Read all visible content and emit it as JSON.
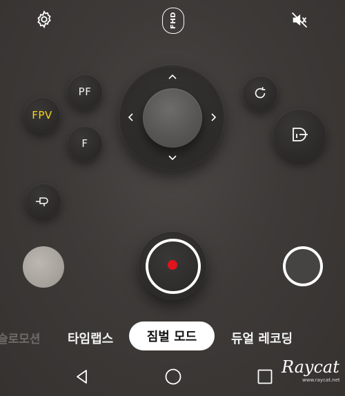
{
  "top_bar": {
    "settings_icon": "gear-icon",
    "resolution_label": "FHD",
    "audio_icon": "mute-icon"
  },
  "left_controls": {
    "pf_label": "PF",
    "fpv_label": "FPV",
    "f_label": "F",
    "recenter_icon": "gimbal-recenter-icon"
  },
  "joystick": {
    "arrows": [
      "up",
      "down",
      "left",
      "right"
    ]
  },
  "right_controls": {
    "rotate_icon": "rotate-icon",
    "lock_icon": "gimbal-lock-icon"
  },
  "modes": {
    "items": [
      "슬로모션",
      "타임랩스",
      "짐벌 모드",
      "듀얼 레코딩"
    ],
    "selected": "짐벌 모드"
  },
  "colors": {
    "accent_fpv": "#f2d51e",
    "record": "#e0141c"
  },
  "watermark": {
    "brand": "Raycat",
    "url": "www.raycat.net"
  }
}
